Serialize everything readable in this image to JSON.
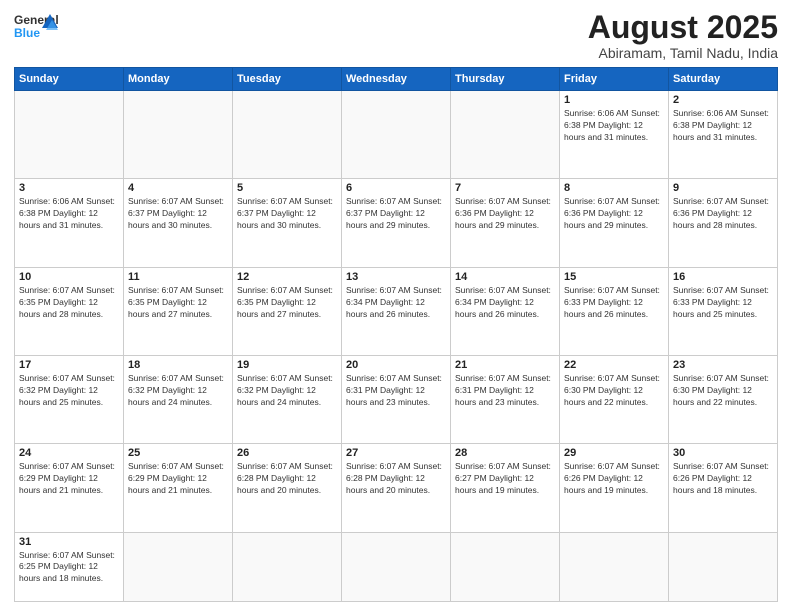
{
  "header": {
    "logo_text_general": "General",
    "logo_text_blue": "Blue",
    "month_title": "August 2025",
    "location": "Abiramam, Tamil Nadu, India"
  },
  "weekdays": [
    "Sunday",
    "Monday",
    "Tuesday",
    "Wednesday",
    "Thursday",
    "Friday",
    "Saturday"
  ],
  "weeks": [
    [
      {
        "day": "",
        "info": ""
      },
      {
        "day": "",
        "info": ""
      },
      {
        "day": "",
        "info": ""
      },
      {
        "day": "",
        "info": ""
      },
      {
        "day": "",
        "info": ""
      },
      {
        "day": "1",
        "info": "Sunrise: 6:06 AM\nSunset: 6:38 PM\nDaylight: 12 hours\nand 31 minutes."
      },
      {
        "day": "2",
        "info": "Sunrise: 6:06 AM\nSunset: 6:38 PM\nDaylight: 12 hours\nand 31 minutes."
      }
    ],
    [
      {
        "day": "3",
        "info": "Sunrise: 6:06 AM\nSunset: 6:38 PM\nDaylight: 12 hours\nand 31 minutes."
      },
      {
        "day": "4",
        "info": "Sunrise: 6:07 AM\nSunset: 6:37 PM\nDaylight: 12 hours\nand 30 minutes."
      },
      {
        "day": "5",
        "info": "Sunrise: 6:07 AM\nSunset: 6:37 PM\nDaylight: 12 hours\nand 30 minutes."
      },
      {
        "day": "6",
        "info": "Sunrise: 6:07 AM\nSunset: 6:37 PM\nDaylight: 12 hours\nand 29 minutes."
      },
      {
        "day": "7",
        "info": "Sunrise: 6:07 AM\nSunset: 6:36 PM\nDaylight: 12 hours\nand 29 minutes."
      },
      {
        "day": "8",
        "info": "Sunrise: 6:07 AM\nSunset: 6:36 PM\nDaylight: 12 hours\nand 29 minutes."
      },
      {
        "day": "9",
        "info": "Sunrise: 6:07 AM\nSunset: 6:36 PM\nDaylight: 12 hours\nand 28 minutes."
      }
    ],
    [
      {
        "day": "10",
        "info": "Sunrise: 6:07 AM\nSunset: 6:35 PM\nDaylight: 12 hours\nand 28 minutes."
      },
      {
        "day": "11",
        "info": "Sunrise: 6:07 AM\nSunset: 6:35 PM\nDaylight: 12 hours\nand 27 minutes."
      },
      {
        "day": "12",
        "info": "Sunrise: 6:07 AM\nSunset: 6:35 PM\nDaylight: 12 hours\nand 27 minutes."
      },
      {
        "day": "13",
        "info": "Sunrise: 6:07 AM\nSunset: 6:34 PM\nDaylight: 12 hours\nand 26 minutes."
      },
      {
        "day": "14",
        "info": "Sunrise: 6:07 AM\nSunset: 6:34 PM\nDaylight: 12 hours\nand 26 minutes."
      },
      {
        "day": "15",
        "info": "Sunrise: 6:07 AM\nSunset: 6:33 PM\nDaylight: 12 hours\nand 26 minutes."
      },
      {
        "day": "16",
        "info": "Sunrise: 6:07 AM\nSunset: 6:33 PM\nDaylight: 12 hours\nand 25 minutes."
      }
    ],
    [
      {
        "day": "17",
        "info": "Sunrise: 6:07 AM\nSunset: 6:32 PM\nDaylight: 12 hours\nand 25 minutes."
      },
      {
        "day": "18",
        "info": "Sunrise: 6:07 AM\nSunset: 6:32 PM\nDaylight: 12 hours\nand 24 minutes."
      },
      {
        "day": "19",
        "info": "Sunrise: 6:07 AM\nSunset: 6:32 PM\nDaylight: 12 hours\nand 24 minutes."
      },
      {
        "day": "20",
        "info": "Sunrise: 6:07 AM\nSunset: 6:31 PM\nDaylight: 12 hours\nand 23 minutes."
      },
      {
        "day": "21",
        "info": "Sunrise: 6:07 AM\nSunset: 6:31 PM\nDaylight: 12 hours\nand 23 minutes."
      },
      {
        "day": "22",
        "info": "Sunrise: 6:07 AM\nSunset: 6:30 PM\nDaylight: 12 hours\nand 22 minutes."
      },
      {
        "day": "23",
        "info": "Sunrise: 6:07 AM\nSunset: 6:30 PM\nDaylight: 12 hours\nand 22 minutes."
      }
    ],
    [
      {
        "day": "24",
        "info": "Sunrise: 6:07 AM\nSunset: 6:29 PM\nDaylight: 12 hours\nand 21 minutes."
      },
      {
        "day": "25",
        "info": "Sunrise: 6:07 AM\nSunset: 6:29 PM\nDaylight: 12 hours\nand 21 minutes."
      },
      {
        "day": "26",
        "info": "Sunrise: 6:07 AM\nSunset: 6:28 PM\nDaylight: 12 hours\nand 20 minutes."
      },
      {
        "day": "27",
        "info": "Sunrise: 6:07 AM\nSunset: 6:28 PM\nDaylight: 12 hours\nand 20 minutes."
      },
      {
        "day": "28",
        "info": "Sunrise: 6:07 AM\nSunset: 6:27 PM\nDaylight: 12 hours\nand 19 minutes."
      },
      {
        "day": "29",
        "info": "Sunrise: 6:07 AM\nSunset: 6:26 PM\nDaylight: 12 hours\nand 19 minutes."
      },
      {
        "day": "30",
        "info": "Sunrise: 6:07 AM\nSunset: 6:26 PM\nDaylight: 12 hours\nand 18 minutes."
      }
    ],
    [
      {
        "day": "31",
        "info": "Sunrise: 6:07 AM\nSunset: 6:25 PM\nDaylight: 12 hours\nand 18 minutes."
      },
      {
        "day": "",
        "info": ""
      },
      {
        "day": "",
        "info": ""
      },
      {
        "day": "",
        "info": ""
      },
      {
        "day": "",
        "info": ""
      },
      {
        "day": "",
        "info": ""
      },
      {
        "day": "",
        "info": ""
      }
    ]
  ]
}
